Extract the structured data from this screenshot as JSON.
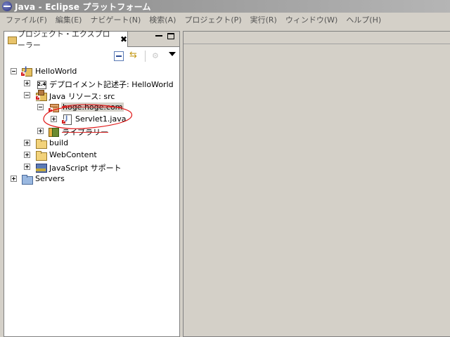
{
  "window": {
    "title": "Java - Eclipse プラットフォーム",
    "app_icon": "eclipse-icon"
  },
  "menubar": {
    "items": [
      {
        "label": "ファイル(F)"
      },
      {
        "label": "編集(E)"
      },
      {
        "label": "ナビゲート(N)"
      },
      {
        "label": "検索(A)"
      },
      {
        "label": "プロジェクト(P)"
      },
      {
        "label": "実行(R)"
      },
      {
        "label": "ウィンドウ(W)"
      },
      {
        "label": "ヘルプ(H)"
      }
    ]
  },
  "explorer": {
    "tab_label": "プロジェクト・エクスプローラー",
    "close_glyph": "✖",
    "toolbar": {
      "collapse_icon": "collapse-all-icon",
      "link_icon": "link-with-editor-icon",
      "filter_icon": "filter-icon",
      "menu_icon": "view-menu-icon"
    },
    "tree": {
      "project": "HelloWorld",
      "deploy_descriptor": "デプロイメント記述子: HelloWorld",
      "java_resources": "Java リソース: src",
      "package": "hoge.hoge.com",
      "servlet": "Servlet1.java",
      "libraries": "ライブラリー",
      "build": "build",
      "webcontent": "WebContent",
      "js_support": "JavaScript サポート",
      "servers": "Servers"
    }
  },
  "colors": {
    "error_badge": "#d42020",
    "annotation_circle": "#e01818",
    "title_bar": "#9a9a9a",
    "selection": "#d4d0c8"
  }
}
